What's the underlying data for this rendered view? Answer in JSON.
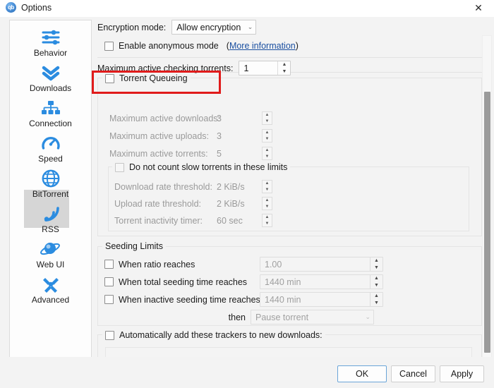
{
  "window": {
    "title": "Options",
    "logo_text": "qb",
    "close_icon": "✕"
  },
  "sidebar": {
    "items": [
      {
        "label": "Behavior",
        "icon": "sliders-icon",
        "selected": false
      },
      {
        "label": "Downloads",
        "icon": "chevrons-down-icon",
        "selected": false
      },
      {
        "label": "Connection",
        "icon": "network-icon",
        "selected": false
      },
      {
        "label": "Speed",
        "icon": "speedometer-icon",
        "selected": false
      },
      {
        "label": "BitTorrent",
        "icon": "globe-icon",
        "selected": true
      },
      {
        "label": "RSS",
        "icon": "rss-icon",
        "selected": false
      },
      {
        "label": "Web UI",
        "icon": "planet-icon",
        "selected": false
      },
      {
        "label": "Advanced",
        "icon": "tools-icon",
        "selected": false
      }
    ]
  },
  "main": {
    "encryption": {
      "label": "Encryption mode:",
      "value": "Allow encryption",
      "chevron": "⌄"
    },
    "anonymous": {
      "label": "Enable anonymous mode",
      "checked": false,
      "link_open": "(",
      "link_text": "More information",
      "link_close": ")"
    },
    "max_checking": {
      "label": "Maximum active checking torrents:",
      "value": "1"
    },
    "queueing": {
      "group_label": "Torrent Queueing",
      "checked": false,
      "rows": [
        {
          "label": "Maximum active downloads:",
          "value": "3"
        },
        {
          "label": "Maximum active uploads:",
          "value": "3"
        },
        {
          "label": "Maximum active torrents:",
          "value": "5"
        }
      ],
      "slow": {
        "label": "Do not count slow torrents in these limits",
        "checked": false,
        "rows": [
          {
            "label": "Download rate threshold:",
            "value": "2 KiB/s"
          },
          {
            "label": "Upload rate threshold:",
            "value": "2 KiB/s"
          },
          {
            "label": "Torrent inactivity timer:",
            "value": "60 sec"
          }
        ]
      }
    },
    "seeding": {
      "group_label": "Seeding Limits",
      "rows": [
        {
          "label": "When ratio reaches",
          "value": "1.00",
          "checked": false
        },
        {
          "label": "When total seeding time reaches",
          "value": "1440 min",
          "checked": false
        },
        {
          "label": "When inactive seeding time reaches",
          "value": "1440 min",
          "checked": false
        }
      ],
      "then_label": "then",
      "then_value": "Pause torrent",
      "then_chevron": "⌄"
    },
    "trackers": {
      "label": "Automatically add these trackers to new downloads:",
      "checked": false,
      "textarea_value": ""
    }
  },
  "buttons": {
    "ok": "OK",
    "cancel": "Cancel",
    "apply": "Apply"
  },
  "colors": {
    "accent_blue": "#2b8ce0",
    "highlight_red": "#e01b1b",
    "selected_bg": "#d6d6d6"
  },
  "spin_up": "▲",
  "spin_down": "▼"
}
